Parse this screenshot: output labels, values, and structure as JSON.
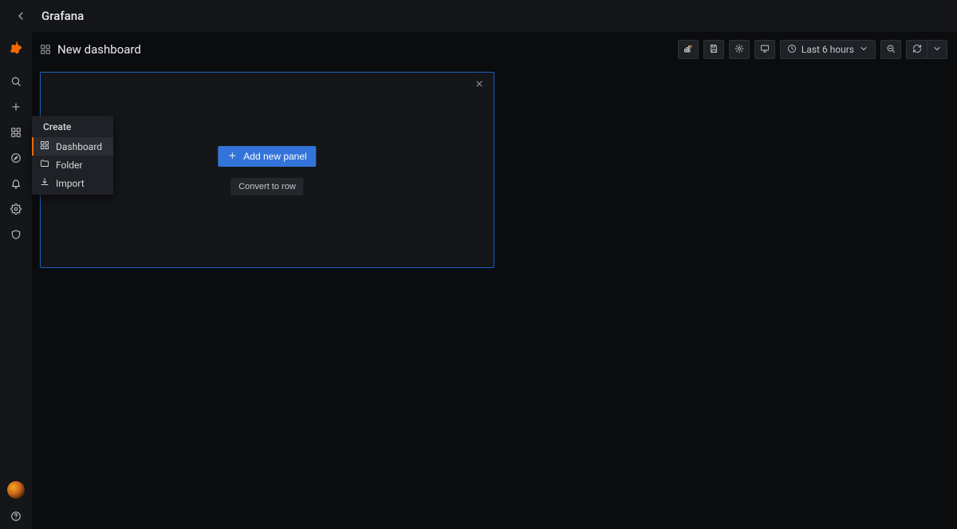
{
  "app": {
    "title": "Grafana"
  },
  "dashboard": {
    "title": "New dashboard"
  },
  "toolbar": {
    "timerange_label": "Last 6 hours"
  },
  "panel_placeholder": {
    "add_label": "Add new panel",
    "convert_label": "Convert to row"
  },
  "create_menu": {
    "title": "Create",
    "items": [
      {
        "label": "Dashboard",
        "icon": "dashboard-grid-icon",
        "active": true
      },
      {
        "label": "Folder",
        "icon": "folder-icon",
        "active": false
      },
      {
        "label": "Import",
        "icon": "import-icon",
        "active": false
      }
    ]
  },
  "sidebar": {
    "items": [
      {
        "name": "search",
        "icon": "search-icon"
      },
      {
        "name": "create",
        "icon": "plus-icon"
      },
      {
        "name": "dashboards",
        "icon": "dashboard-grid-icon"
      },
      {
        "name": "explore",
        "icon": "compass-icon"
      },
      {
        "name": "alerting",
        "icon": "bell-icon"
      },
      {
        "name": "config",
        "icon": "gear-icon"
      },
      {
        "name": "admin",
        "icon": "shield-icon"
      }
    ]
  }
}
